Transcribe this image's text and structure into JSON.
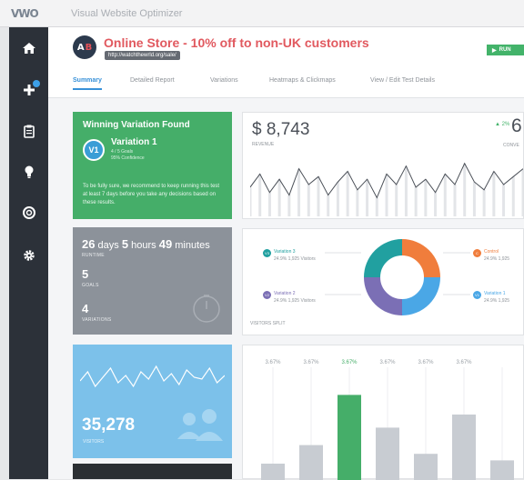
{
  "app": {
    "logo": "VWO",
    "name": "Visual Website Optimizer"
  },
  "sidebar": {
    "items": [
      {
        "name": "home",
        "icon": "home-icon"
      },
      {
        "name": "create",
        "icon": "plus-icon",
        "has_badge": true
      },
      {
        "name": "reports",
        "icon": "clipboard-icon"
      },
      {
        "name": "ideas",
        "icon": "lightbulb-icon"
      },
      {
        "name": "help",
        "icon": "lifebuoy-icon"
      },
      {
        "name": "settings",
        "icon": "gear-icon"
      }
    ]
  },
  "campaign": {
    "logo_a": "A",
    "logo_b": "B",
    "title": "Online Store - 10% off to non-UK customers",
    "url": "http://watchthewrld.org/sale/",
    "run_label": "RUN"
  },
  "tabs": [
    {
      "label": "Summary",
      "active": true
    },
    {
      "label": "Detailed Report",
      "active": false
    },
    {
      "label": "Variations",
      "active": false
    },
    {
      "label": "Heatmaps & Clickmaps",
      "active": false
    },
    {
      "label": "View / Edit Test Details",
      "active": false
    }
  ],
  "winner": {
    "heading": "Winning Variation Found",
    "badge": "V1",
    "variation": "Variation 1",
    "goals": "4 / 5 Goals",
    "confidence": "95% Confidence",
    "note": "To be fully sure, we recommend to keep running this test at least 7 days before you take any decisions based on these results."
  },
  "runtime": {
    "days": "26",
    "days_unit": "days",
    "hours": "5",
    "hours_unit": "hours",
    "minutes": "49",
    "minutes_unit": "minutes",
    "runtime_label": "RUNTIME",
    "goals_value": "5",
    "goals_label": "GOALS",
    "variations_value": "4",
    "variations_label": "VARIATIONS"
  },
  "visitors": {
    "value": "35,278",
    "label": "VISITORS"
  },
  "revenue": {
    "value": "$ 8,743",
    "label": "REVENUE",
    "conv_change": "▲ 2%",
    "conv_value": "6",
    "conv_label": "CONVE"
  },
  "split": {
    "label": "VISITORS SPLIT",
    "legend": [
      {
        "badge": "V3",
        "name": "Variation 3",
        "share": "24.9%",
        "visitors": "1,925 Visitors",
        "color": "#21a0a0"
      },
      {
        "badge": "V2",
        "name": "Variation 2",
        "share": "24.9%",
        "visitors": "1,925 Visitors",
        "color": "#7b6fb5"
      },
      {
        "badge": "C",
        "name": "Control",
        "share": "24.9%",
        "visitors": "1,925",
        "color": "#f07d3c"
      },
      {
        "badge": "V1",
        "name": "Variation 1",
        "share": "24.9%",
        "visitors": "1,925",
        "color": "#4aa7e6"
      }
    ]
  },
  "bars": {
    "labels": [
      "3.67%",
      "3.67%",
      "3.67%",
      "3.67%",
      "3.67%",
      "3.67%"
    ],
    "values": [
      0.15,
      0.32,
      0.78,
      0.48,
      0.24,
      0.6,
      0.18
    ],
    "highlight_index": 2,
    "colors": {
      "normal": "#c8ccd2",
      "highlight": "#45ae69"
    }
  },
  "revenue_line": {
    "values": [
      0.45,
      0.7,
      0.35,
      0.6,
      0.3,
      0.8,
      0.5,
      0.65,
      0.3,
      0.55,
      0.75,
      0.4,
      0.6,
      0.25,
      0.7,
      0.5,
      0.85,
      0.45,
      0.6,
      0.35,
      0.7,
      0.5,
      0.9,
      0.55,
      0.4,
      0.75,
      0.5,
      0.65,
      0.8
    ]
  },
  "visitors_line": {
    "values": [
      0.45,
      0.7,
      0.3,
      0.55,
      0.8,
      0.4,
      0.6,
      0.3,
      0.7,
      0.5,
      0.85,
      0.45,
      0.65,
      0.35,
      0.75,
      0.55,
      0.5,
      0.8,
      0.4,
      0.6
    ]
  }
}
